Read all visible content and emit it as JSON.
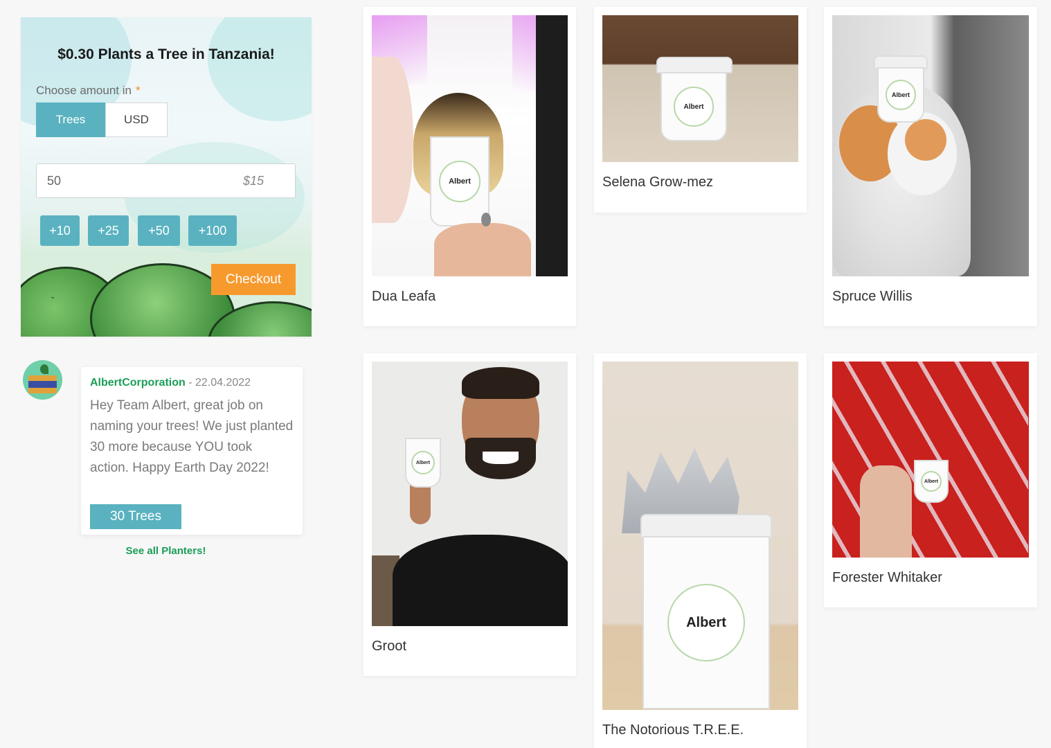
{
  "widget": {
    "title": "$0.30 Plants a Tree in Tanzania!",
    "choose_label": "Choose amount in",
    "required_mark": "*",
    "toggle_trees": "Trees",
    "toggle_usd": "USD",
    "amount_value": "50",
    "amount_usd": "$15",
    "quick_add": [
      "+10",
      "+25",
      "+50",
      "+100"
    ],
    "checkout_label": "Checkout"
  },
  "comment": {
    "user": "AlbertCorporation",
    "date": " - 22.04.2022",
    "text": "Hey Team Albert, great job on naming your trees! We just planted 30 more because YOU took action. Happy Earth Day 2022!",
    "badge": "30 Trees"
  },
  "see_all_label": "See all Planters!",
  "cards": [
    {
      "name": "Dua Leafa",
      "logo": "Albert"
    },
    {
      "name": "Selena Grow-mez",
      "logo": "Albert"
    },
    {
      "name": "Spruce Willis",
      "logo": "Albert"
    },
    {
      "name": "Groot",
      "logo": "Albert"
    },
    {
      "name": "The Notorious T.R.E.E.",
      "logo": "Albert"
    },
    {
      "name": "Forester Whitaker",
      "logo": "Albert"
    }
  ]
}
